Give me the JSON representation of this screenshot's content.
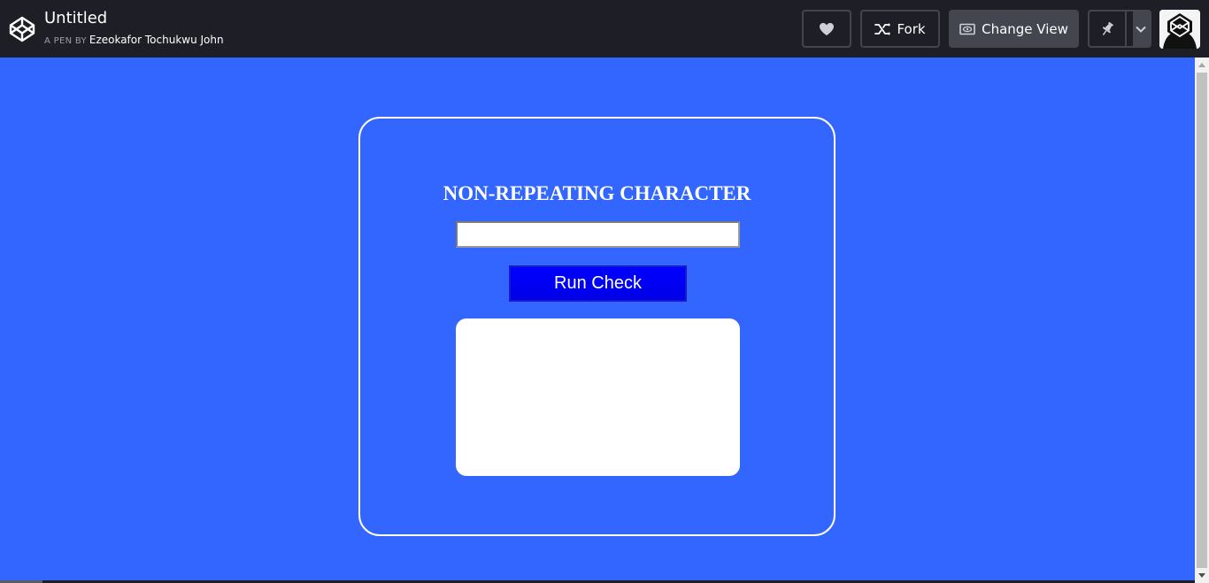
{
  "header": {
    "title": "Untitled",
    "byline_prefix": "A PEN BY",
    "author": "Ezeokafor Tochukwu John",
    "buttons": {
      "fork_label": "Fork",
      "change_view_label": "Change View"
    },
    "icons": {
      "logo": "codepen-logo-icon",
      "like": "heart-icon",
      "fork": "fork-icon",
      "change_view": "eye-icon",
      "pin": "pin-icon",
      "dropdown": "chevron-down-icon"
    }
  },
  "app": {
    "title": "NON-REPEATING CHARACTER",
    "input_value": "",
    "button_label": "Run Check",
    "result_text": ""
  },
  "colors": {
    "topbar": "#1e1f26",
    "page_background": "#3366ff",
    "button": "#0000ff",
    "card_border": "#ffffff"
  }
}
